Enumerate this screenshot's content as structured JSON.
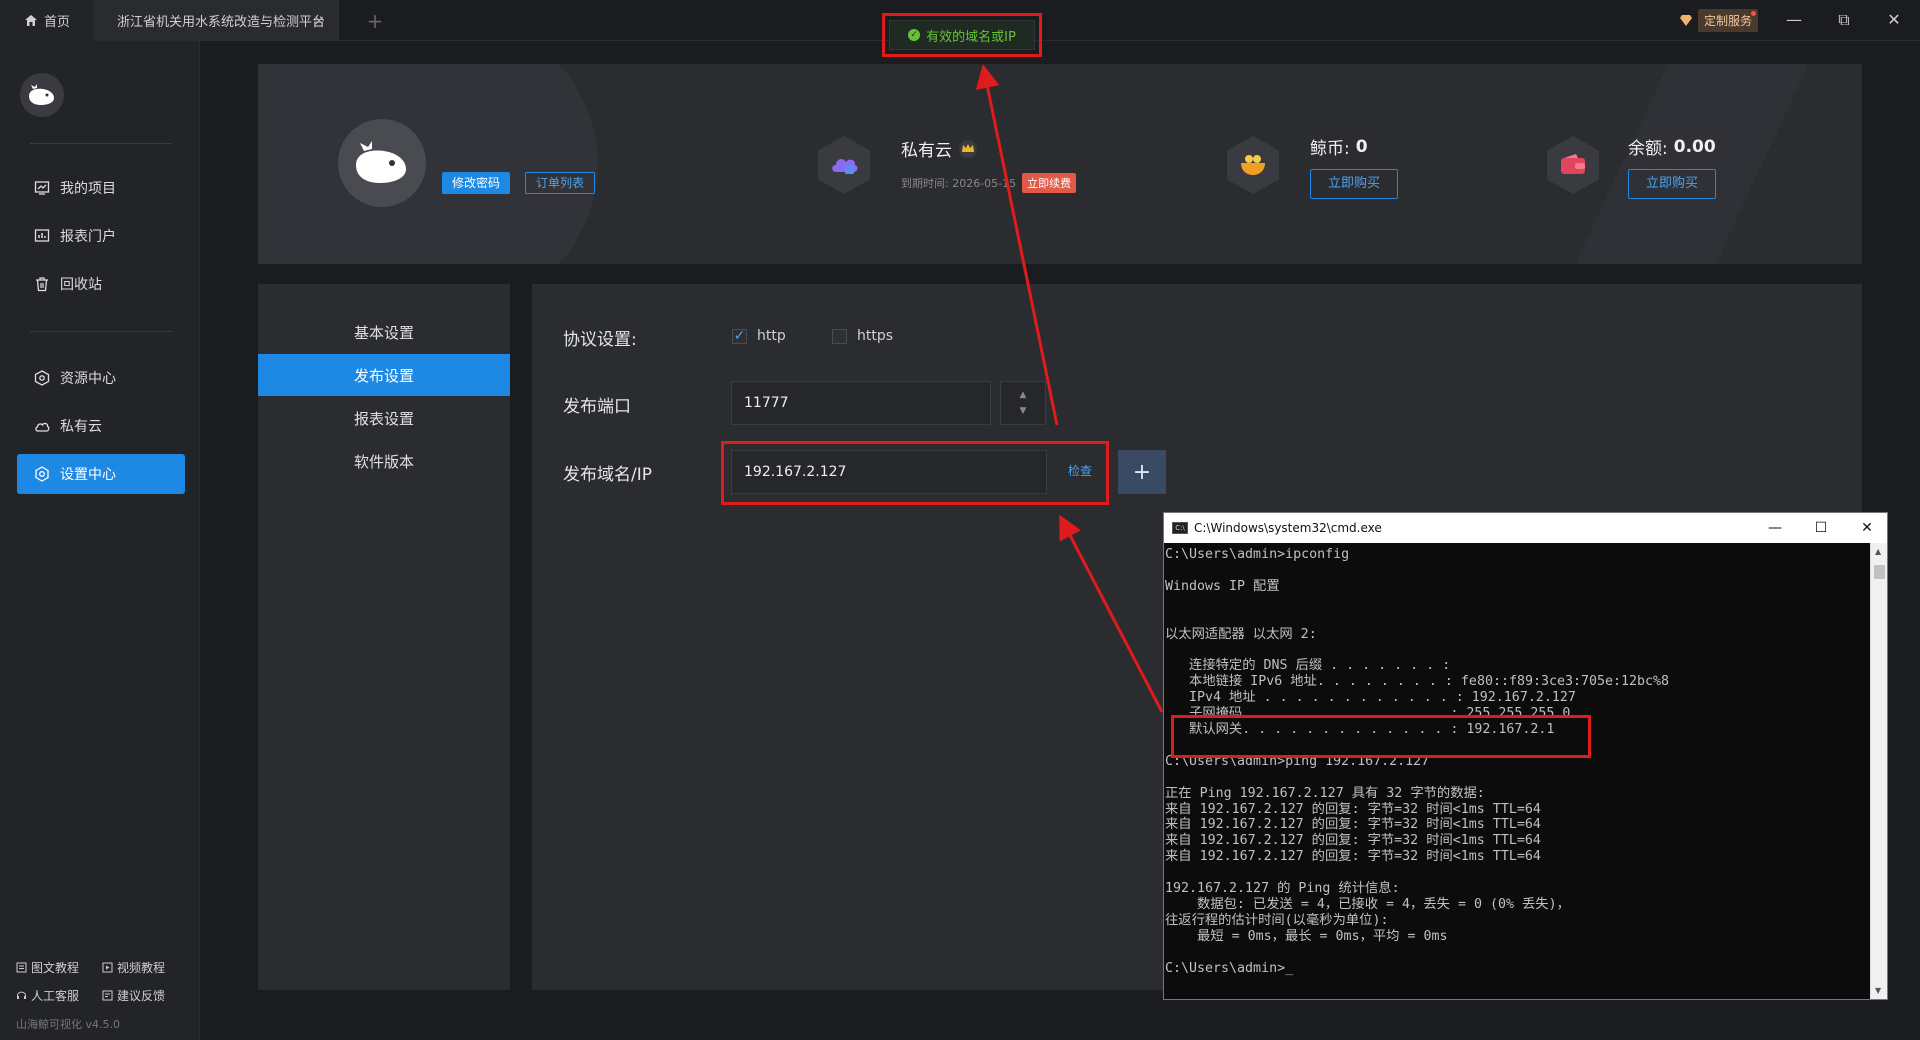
{
  "tabs": {
    "home": "首页",
    "project": "浙江省机关用水系统改造与检测平台",
    "close": "×",
    "add": "+"
  },
  "topbar": {
    "custom_service": "定制服务",
    "minimize": "—",
    "maximize": "⧉",
    "close": "✕"
  },
  "toast": {
    "message": "有效的域名或IP",
    "color": "#67c23a"
  },
  "sidebar": {
    "items": [
      {
        "label": "我的项目",
        "icon": "project-icon"
      },
      {
        "label": "报表门户",
        "icon": "report-portal-icon"
      },
      {
        "label": "回收站",
        "icon": "trash-icon"
      },
      {
        "label": "资源中心",
        "icon": "resource-icon"
      },
      {
        "label": "私有云",
        "icon": "cloud-icon"
      },
      {
        "label": "设置中心",
        "icon": "settings-icon"
      }
    ],
    "footer": {
      "doc_tutorial": "图文教程",
      "video_tutorial": "视频教程",
      "support": "人工客服",
      "feedback": "建议反馈"
    },
    "version": "山海鲸可视化 v4.5.0"
  },
  "profile": {
    "change_password": "修改密码",
    "order_list": "订单列表",
    "private_cloud": {
      "title": "私有云",
      "expire_label": "到期时间: 2026-05-15",
      "renew": "立即续费"
    },
    "coins": {
      "label": "鲸币:",
      "value": "0",
      "buy": "立即购买"
    },
    "balance": {
      "label": "余额:",
      "value": "0.00",
      "buy": "立即购买"
    }
  },
  "settings_menu": {
    "items": [
      "基本设置",
      "发布设置",
      "报表设置",
      "软件版本"
    ],
    "active_index": 1
  },
  "settings_panel": {
    "protocol_label": "协议设置:",
    "http": "http",
    "https": "https",
    "http_checked": true,
    "https_checked": false,
    "port_label": "发布端口",
    "port_value": "11777",
    "domain_label": "发布域名/IP",
    "domain_value": "192.167.2.127",
    "check": "检查",
    "add": "+"
  },
  "cmd": {
    "title": "C:\\Windows\\system32\\cmd.exe",
    "lines": [
      "C:\\Users\\admin>ipconfig",
      "",
      "Windows IP 配置",
      "",
      "",
      "以太网适配器 以太网 2:",
      "",
      "   连接特定的 DNS 后缀 . . . . . . . :",
      "   本地链接 IPv6 地址. . . . . . . . : fe80::f89:3ce3:705e:12bc%8",
      "   IPv4 地址 . . . . . . . . . . . . : 192.167.2.127",
      "   子网掩码  . . . . . . . . . . . . : 255.255.255.0",
      "   默认网关. . . . . . . . . . . . . : 192.167.2.1",
      "",
      "C:\\Users\\admin>ping 192.167.2.127",
      "",
      "正在 Ping 192.167.2.127 具有 32 字节的数据:",
      "来自 192.167.2.127 的回复: 字节=32 时间<1ms TTL=64",
      "来自 192.167.2.127 的回复: 字节=32 时间<1ms TTL=64",
      "来自 192.167.2.127 的回复: 字节=32 时间<1ms TTL=64",
      "来自 192.167.2.127 的回复: 字节=32 时间<1ms TTL=64",
      "",
      "192.167.2.127 的 Ping 统计信息:",
      "    数据包: 已发送 = 4，已接收 = 4，丢失 = 0 (0% 丢失)，",
      "往返行程的估计时间(以毫秒为单位):",
      "    最短 = 0ms，最长 = 0ms，平均 = 0ms",
      "",
      "C:\\Users\\admin>_"
    ]
  },
  "colors": {
    "accent": "#1e88e5",
    "annotation": "#e01b1b",
    "success": "#67c23a",
    "renew": "#e05a47"
  }
}
